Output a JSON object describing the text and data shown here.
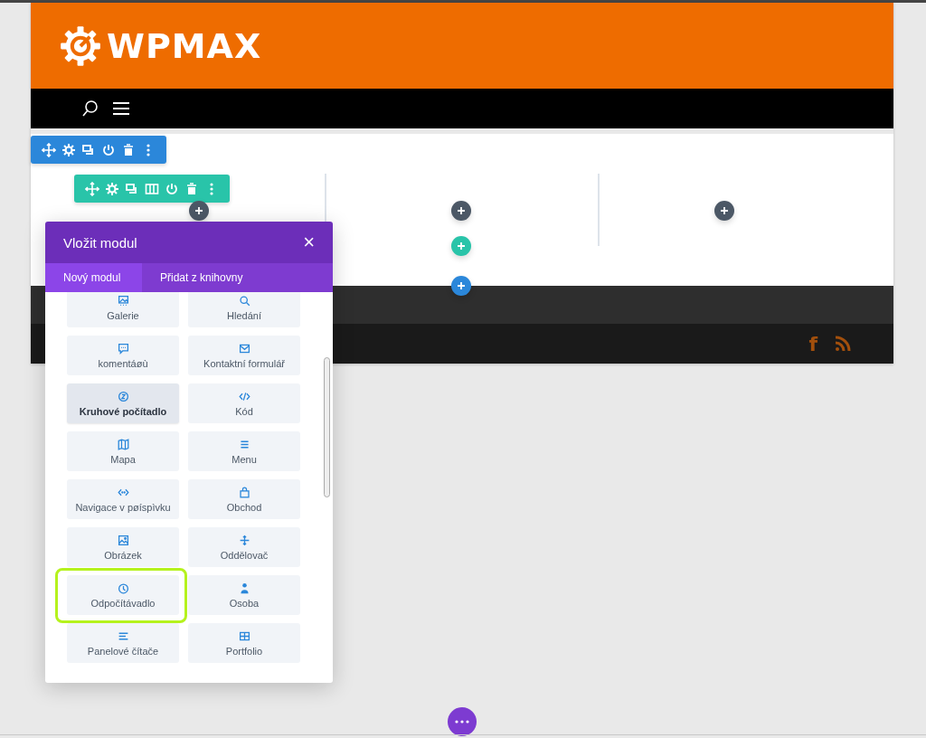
{
  "header": {
    "logo_text": "WPMAX"
  },
  "footer": {
    "social_glyph": "f"
  },
  "modal": {
    "title": "Vložit modul",
    "close": "×",
    "tabs": [
      {
        "label": "Nový modul",
        "selected": true
      },
      {
        "label": "Přidat z knihovny",
        "selected": false
      }
    ],
    "modules": [
      {
        "label": "Galerie",
        "hovered": false,
        "highlighted": false
      },
      {
        "label": "Hledání",
        "hovered": false,
        "highlighted": false
      },
      {
        "label": "komentáøù",
        "hovered": false,
        "highlighted": false
      },
      {
        "label": "Kontaktní formulář",
        "hovered": false,
        "highlighted": false
      },
      {
        "label": "Kruhové počítadlo",
        "hovered": true,
        "highlighted": false
      },
      {
        "label": "Kód",
        "hovered": false,
        "highlighted": false
      },
      {
        "label": "Mapa",
        "hovered": false,
        "highlighted": false
      },
      {
        "label": "Menu",
        "hovered": false,
        "highlighted": false
      },
      {
        "label": "Navigace v pøíspìvku",
        "hovered": false,
        "highlighted": false
      },
      {
        "label": "Obchod",
        "hovered": false,
        "highlighted": false
      },
      {
        "label": "Obrázek",
        "hovered": false,
        "highlighted": false
      },
      {
        "label": "Oddělovač",
        "hovered": false,
        "highlighted": false
      },
      {
        "label": "Odpočítávadlo",
        "hovered": false,
        "highlighted": true
      },
      {
        "label": "Osoba",
        "hovered": false,
        "highlighted": false
      },
      {
        "label": "Panelové čítače",
        "hovered": false,
        "highlighted": false
      },
      {
        "label": "Portfolio",
        "hovered": false,
        "highlighted": false
      }
    ]
  }
}
